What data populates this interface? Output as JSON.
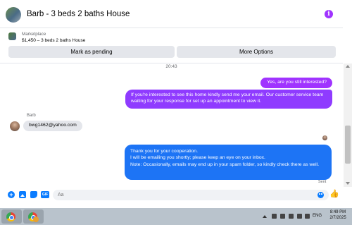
{
  "header": {
    "title": "Barb - 3 beds 2 baths House",
    "info_icon": "i"
  },
  "marketplace": {
    "label": "Marketplace",
    "listing": "$1,450 – 3 beds 2 baths House",
    "mark_pending_label": "Mark as pending",
    "more_options_label": "More Options"
  },
  "conversation": {
    "timestamp": "20:43",
    "messages": [
      {
        "from": "me",
        "text": "Yes, are you still interested?"
      },
      {
        "from": "me",
        "text": "If you're interested to see this home kindly  send me your email. Our customer service team waiting for your response for set up an appointment to view it."
      },
      {
        "from": "Barb",
        "sender_name": "Barb",
        "text": "bwg1462@yahoo.com"
      },
      {
        "from": "me",
        "lines": [
          "Thank you for your cooperation.",
          "I will be emailing you shortly; please keep an eye on your inbox.",
          "Note: Occasionally, emails may end up in your spam folder, so kindly check there as well."
        ]
      }
    ],
    "delivery_status": "Sent"
  },
  "composer": {
    "placeholder": "Aa",
    "icons": [
      "plus-icon",
      "photo-icon",
      "sticker-icon",
      "gif-icon",
      "emoji-icon",
      "like-icon"
    ],
    "gif_label": "GIF"
  },
  "taskbar": {
    "language": "ENG",
    "time": "8:49 PM",
    "date": "2/7/2025"
  },
  "colors": {
    "accent_purple": "#a033ff",
    "accent_blue": "#1d74f5",
    "taskbar": "#b9c3cc"
  }
}
